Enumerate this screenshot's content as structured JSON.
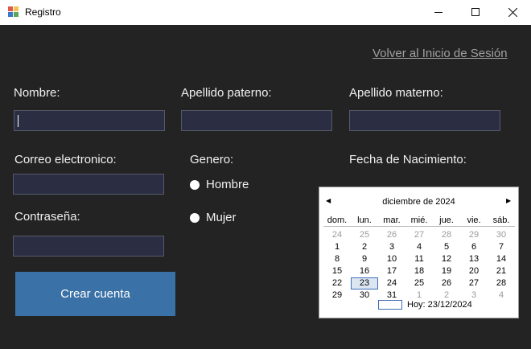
{
  "window": {
    "title": "Registro"
  },
  "header": {
    "back_link": "Volver al Inicio de Sesión"
  },
  "form": {
    "nombre_label": "Nombre:",
    "apellido_paterno_label": "Apellido paterno:",
    "apellido_materno_label": "Apellido materno:",
    "correo_label": "Correo electronico:",
    "genero_label": "Genero:",
    "fecha_label": "Fecha de Nacimiento:",
    "contrasena_label": "Contraseña:",
    "genero_options": [
      "Hombre",
      "Mujer"
    ],
    "submit_label": "Crear cuenta"
  },
  "calendar": {
    "month_title": "diciembre de 2024",
    "weekdays": [
      "dom.",
      "lun.",
      "mar.",
      "mié.",
      "jue.",
      "vie.",
      "sáb."
    ],
    "weeks": [
      [
        "24",
        "25",
        "26",
        "27",
        "28",
        "29",
        "30"
      ],
      [
        "1",
        "2",
        "3",
        "4",
        "5",
        "6",
        "7"
      ],
      [
        "8",
        "9",
        "10",
        "11",
        "12",
        "13",
        "14"
      ],
      [
        "15",
        "16",
        "17",
        "18",
        "19",
        "20",
        "21"
      ],
      [
        "22",
        "23",
        "24",
        "25",
        "26",
        "27",
        "28"
      ],
      [
        "29",
        "30",
        "31",
        "1",
        "2",
        "3",
        "4"
      ]
    ],
    "today_label": "Hoy: 23/12/2024",
    "selected_day": "23"
  },
  "colors": {
    "background": "#232323",
    "input_bg": "#2b2d42",
    "button_bg": "#3a71a7",
    "link": "#a0a0a0"
  }
}
